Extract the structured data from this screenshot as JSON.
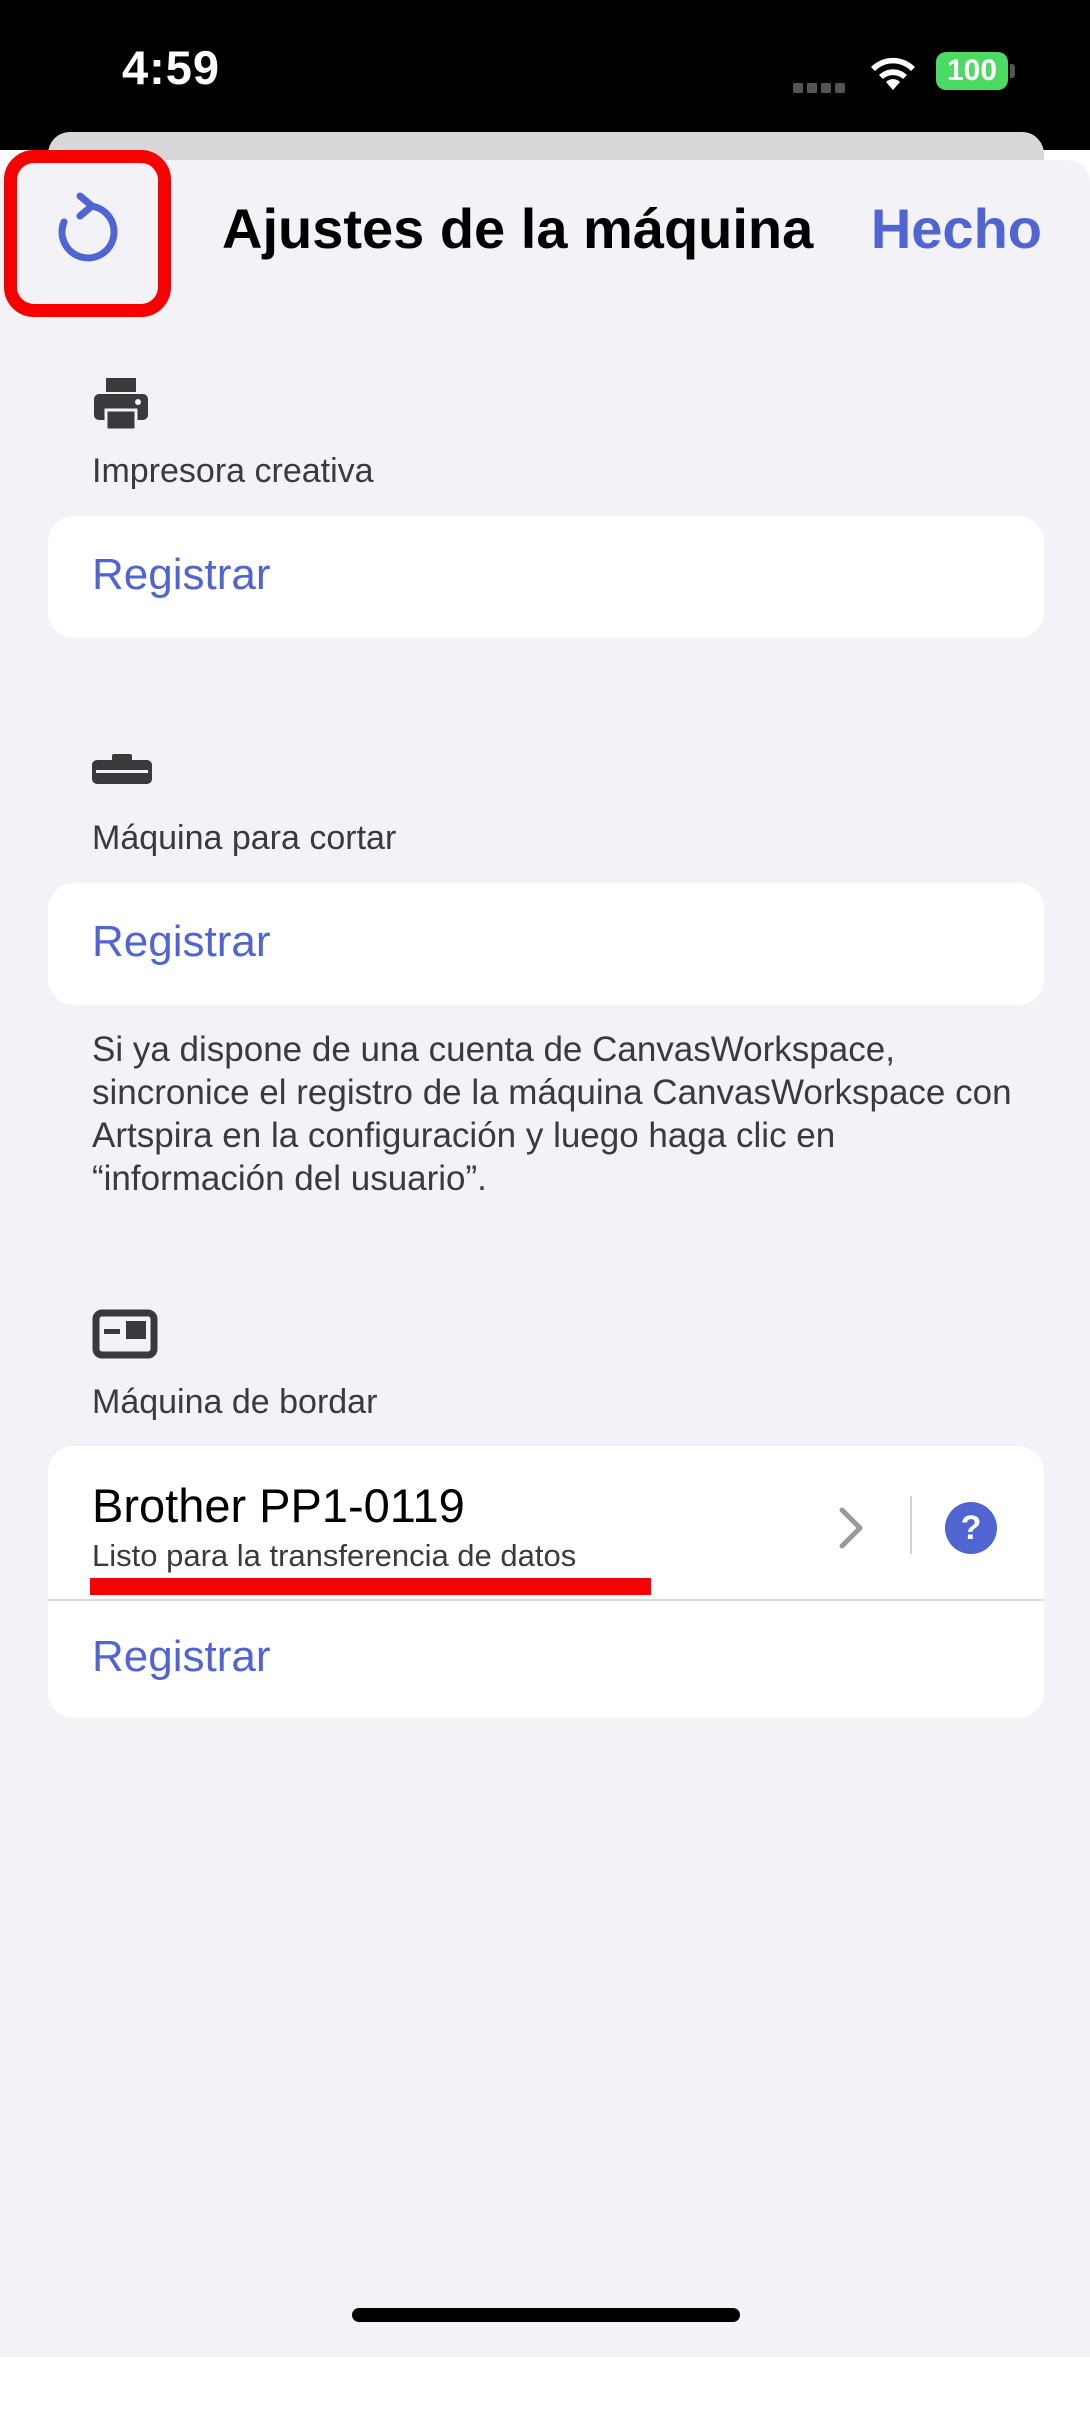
{
  "status_bar": {
    "time": "4:59",
    "battery": "100",
    "battery_color": "#4cd964"
  },
  "header": {
    "refresh_icon": "refresh-icon",
    "title": "Ajustes de la máquina",
    "done_label": "Hecho"
  },
  "sections": {
    "printer": {
      "icon": "printer-icon",
      "label": "Impresora creativa",
      "register_label": "Registrar"
    },
    "cutter": {
      "icon": "cutting-machine-icon",
      "label": "Máquina para cortar",
      "register_label": "Registrar",
      "note": "Si ya dispone de una cuenta de CanvasWorkspace, sincronice el registro de la máquina CanvasWorkspace con Artspira en la configuración y luego haga clic en “información del usuario”."
    },
    "embroidery": {
      "icon": "embroidery-machine-icon",
      "label": "Máquina de bordar",
      "device": {
        "name": "Brother PP1-0119",
        "status": "Listo para la transferencia de datos",
        "help_symbol": "?"
      },
      "register_label": "Registrar"
    }
  },
  "colors": {
    "accent": "#5064d2",
    "highlight": "#f60000",
    "background": "#f2f2f7"
  }
}
